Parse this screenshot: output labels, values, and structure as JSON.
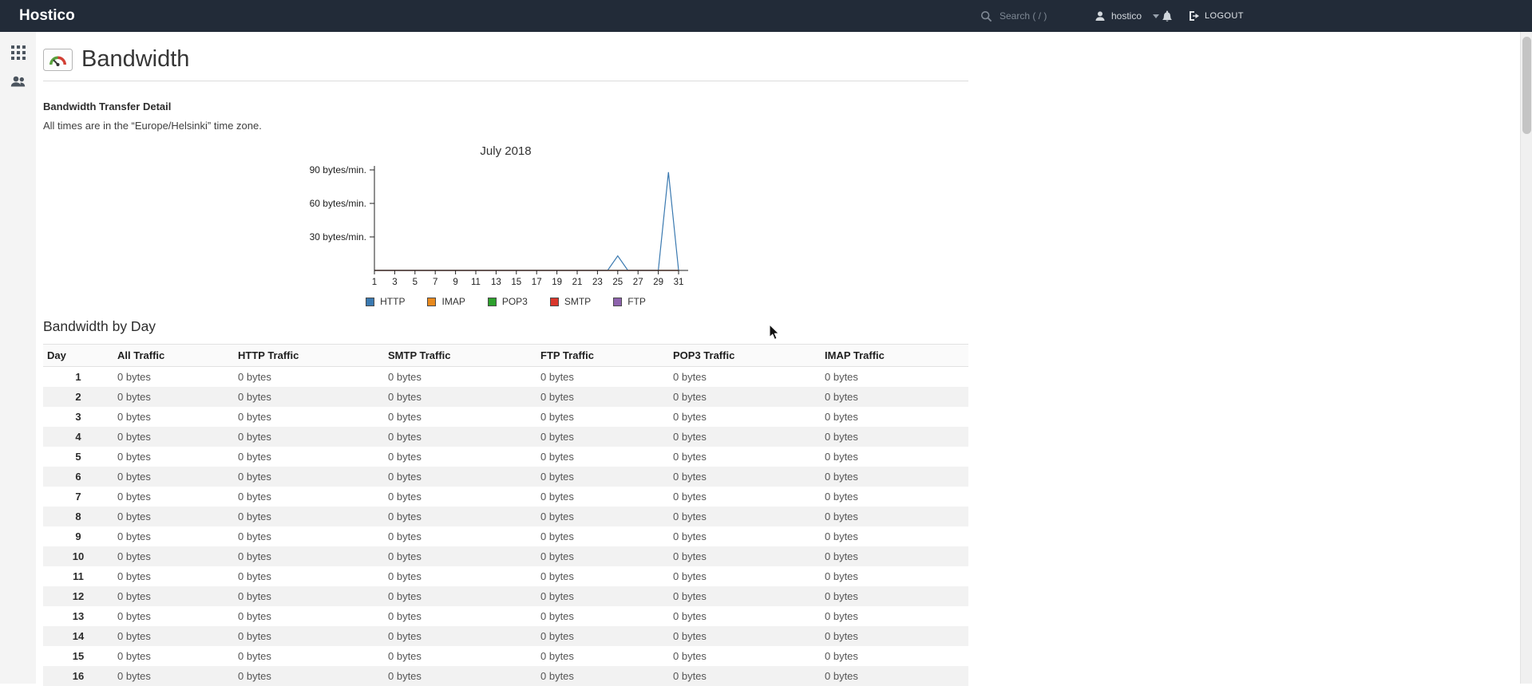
{
  "topbar": {
    "brand": "Hostico",
    "search_placeholder": "Search ( / )",
    "user": "hostico",
    "logout_label": "LOGOUT"
  },
  "sidebar": {
    "items": [
      {
        "name": "apps",
        "icon": "grid-icon"
      },
      {
        "name": "users",
        "icon": "users-icon"
      }
    ]
  },
  "page": {
    "title": "Bandwidth",
    "section_title": "Bandwidth Transfer Detail",
    "timezone_note": "All times are in the “Europe/Helsinki” time zone.",
    "by_day_title": "Bandwidth by Day"
  },
  "colors": {
    "topbar_bg": "#222b38",
    "sidebar_bg": "#f4f4f4",
    "zebra_row": "#f2f2f2"
  },
  "icons": [
    "search-icon",
    "user-icon",
    "chevron-down-icon",
    "bell-icon",
    "logout-icon",
    "grid-icon",
    "users-icon",
    "bandwidth-gauge-icon",
    "mouse-cursor"
  ],
  "chart_data": {
    "type": "line",
    "title": "July 2018",
    "xlabel": "",
    "ylabel": "",
    "xlim": [
      1,
      31
    ],
    "ylim": [
      0,
      95
    ],
    "grid": false,
    "legend_position": "bottom",
    "x": [
      1,
      2,
      3,
      4,
      5,
      6,
      7,
      8,
      9,
      10,
      11,
      12,
      13,
      14,
      15,
      16,
      17,
      18,
      19,
      20,
      21,
      22,
      23,
      24,
      25,
      26,
      27,
      28,
      29,
      30,
      31
    ],
    "x_ticks": [
      1,
      3,
      5,
      7,
      9,
      11,
      13,
      15,
      17,
      19,
      21,
      23,
      25,
      27,
      29,
      31
    ],
    "y_ticks": [
      {
        "value": 90,
        "label": "90 bytes/min."
      },
      {
        "value": 60,
        "label": "60 bytes/min."
      },
      {
        "value": 30,
        "label": "30 bytes/min."
      }
    ],
    "legend": [
      {
        "name": "HTTP",
        "color": "#3a79b0"
      },
      {
        "name": "IMAP",
        "color": "#e8891d"
      },
      {
        "name": "POP3",
        "color": "#2ca02c"
      },
      {
        "name": "SMTP",
        "color": "#d9362b"
      },
      {
        "name": "FTP",
        "color": "#8e63ad"
      }
    ],
    "series": [
      {
        "name": "HTTP",
        "color": "#3a79b0",
        "values": [
          0,
          0,
          0,
          0,
          0,
          0,
          0,
          0,
          0,
          0,
          0,
          0,
          0,
          0,
          0,
          0,
          0,
          0,
          0,
          0,
          0,
          0,
          0,
          0,
          13,
          0,
          0,
          0,
          0,
          88,
          0
        ]
      },
      {
        "name": "IMAP",
        "color": "#e8891d",
        "values": [
          0,
          0,
          0,
          0,
          0,
          0,
          0,
          0,
          0,
          0,
          0,
          0,
          0,
          0,
          0,
          0,
          0,
          0,
          0,
          0,
          0,
          0,
          0,
          0,
          0,
          0,
          0,
          0,
          0,
          0,
          0
        ]
      },
      {
        "name": "POP3",
        "color": "#2ca02c",
        "values": [
          0,
          0,
          0,
          0,
          0,
          0,
          0,
          0,
          0,
          0,
          0,
          0,
          0,
          0,
          0,
          0,
          0,
          0,
          0,
          0,
          0,
          0,
          0,
          0,
          0,
          0,
          0,
          0,
          0,
          0,
          0
        ]
      },
      {
        "name": "SMTP",
        "color": "#d9362b",
        "values": [
          0,
          0,
          0,
          0,
          0,
          0,
          0,
          0,
          0,
          0,
          0,
          0,
          0,
          0,
          0,
          0,
          0,
          0,
          0,
          0,
          0,
          0,
          0,
          0,
          0,
          0,
          0,
          0,
          0,
          0,
          0
        ]
      },
      {
        "name": "FTP",
        "color": "#8e63ad",
        "values": [
          0,
          0,
          0,
          0,
          0,
          0,
          0,
          0,
          0,
          0,
          0,
          0,
          0,
          0,
          0,
          0,
          0,
          0,
          0,
          0,
          0,
          0,
          0,
          0,
          0,
          0,
          0,
          0,
          0,
          0,
          0
        ]
      }
    ]
  },
  "table": {
    "headers": [
      "Day",
      "All Traffic",
      "HTTP Traffic",
      "SMTP Traffic",
      "FTP Traffic",
      "POP3 Traffic",
      "IMAP Traffic"
    ],
    "rows": [
      [
        "1",
        "0 bytes",
        "0 bytes",
        "0 bytes",
        "0 bytes",
        "0 bytes",
        "0 bytes"
      ],
      [
        "2",
        "0 bytes",
        "0 bytes",
        "0 bytes",
        "0 bytes",
        "0 bytes",
        "0 bytes"
      ],
      [
        "3",
        "0 bytes",
        "0 bytes",
        "0 bytes",
        "0 bytes",
        "0 bytes",
        "0 bytes"
      ],
      [
        "4",
        "0 bytes",
        "0 bytes",
        "0 bytes",
        "0 bytes",
        "0 bytes",
        "0 bytes"
      ],
      [
        "5",
        "0 bytes",
        "0 bytes",
        "0 bytes",
        "0 bytes",
        "0 bytes",
        "0 bytes"
      ],
      [
        "6",
        "0 bytes",
        "0 bytes",
        "0 bytes",
        "0 bytes",
        "0 bytes",
        "0 bytes"
      ],
      [
        "7",
        "0 bytes",
        "0 bytes",
        "0 bytes",
        "0 bytes",
        "0 bytes",
        "0 bytes"
      ],
      [
        "8",
        "0 bytes",
        "0 bytes",
        "0 bytes",
        "0 bytes",
        "0 bytes",
        "0 bytes"
      ],
      [
        "9",
        "0 bytes",
        "0 bytes",
        "0 bytes",
        "0 bytes",
        "0 bytes",
        "0 bytes"
      ],
      [
        "10",
        "0 bytes",
        "0 bytes",
        "0 bytes",
        "0 bytes",
        "0 bytes",
        "0 bytes"
      ],
      [
        "11",
        "0 bytes",
        "0 bytes",
        "0 bytes",
        "0 bytes",
        "0 bytes",
        "0 bytes"
      ],
      [
        "12",
        "0 bytes",
        "0 bytes",
        "0 bytes",
        "0 bytes",
        "0 bytes",
        "0 bytes"
      ],
      [
        "13",
        "0 bytes",
        "0 bytes",
        "0 bytes",
        "0 bytes",
        "0 bytes",
        "0 bytes"
      ],
      [
        "14",
        "0 bytes",
        "0 bytes",
        "0 bytes",
        "0 bytes",
        "0 bytes",
        "0 bytes"
      ],
      [
        "15",
        "0 bytes",
        "0 bytes",
        "0 bytes",
        "0 bytes",
        "0 bytes",
        "0 bytes"
      ],
      [
        "16",
        "0 bytes",
        "0 bytes",
        "0 bytes",
        "0 bytes",
        "0 bytes",
        "0 bytes"
      ]
    ]
  }
}
